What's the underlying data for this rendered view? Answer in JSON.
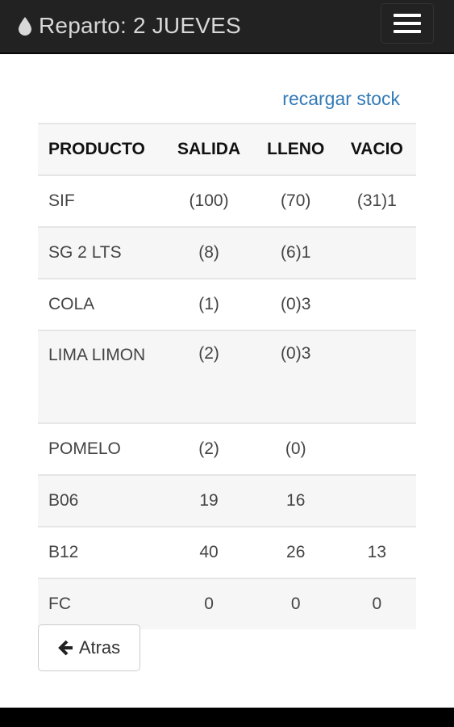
{
  "header": {
    "title": "Reparto: 2 JUEVES",
    "brand_icon": "tint-icon",
    "menu_icon": "hamburger-menu-icon"
  },
  "actions": {
    "reload_label": "recargar stock"
  },
  "table": {
    "columns": [
      "PRODUCTO",
      "SALIDA",
      "LLENO",
      "VACIO"
    ],
    "rows": [
      [
        "SIF",
        "(100)",
        "(70)",
        "(31)1"
      ],
      [
        "SG 2 LTS",
        "(8)",
        "(6)1",
        ""
      ],
      [
        "COLA",
        "(1)",
        "(0)3",
        ""
      ],
      [
        "LIMA LIMON",
        "(2)",
        "(0)3",
        ""
      ],
      [
        "POMELO",
        "(2)",
        "(0)",
        ""
      ],
      [
        "B06",
        "19",
        "16",
        ""
      ],
      [
        "B12",
        "40",
        "26",
        "13"
      ],
      [
        "FC",
        "0",
        "0",
        "0"
      ]
    ]
  },
  "footer": {
    "back_label": "Atras",
    "back_icon": "arrow-left-icon"
  },
  "colors": {
    "navbar": "#222222",
    "link": "#337ab7"
  }
}
